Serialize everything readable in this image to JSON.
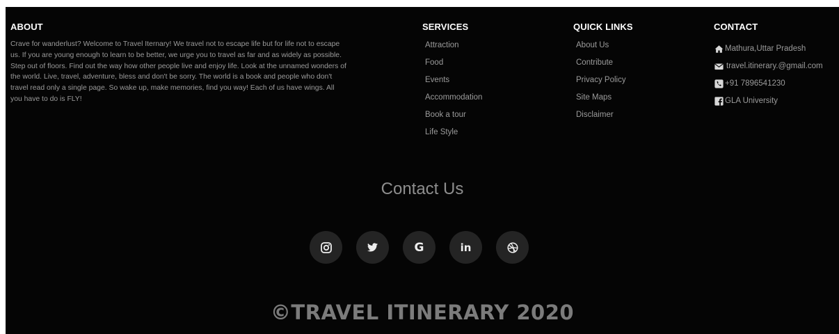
{
  "about": {
    "heading": "ABOUT",
    "text": "Crave for wanderlust? Welcome to Travel Iternary! We travel not to escape life but for life not to escape us. If you are young enough to learn to be better, we urge you to travel as far and as widely as possible. Step out of floors. Find out the way how other people live and enjoy life. Look at the unnamed wonders of the world. Live, travel, adventure, bless and don't be sorry. The world is a book and people who don't travel read only a single page. So wake up, make memories, find you way! Each of us have wings. All you have to do is FLY!"
  },
  "services": {
    "heading": "SERVICES",
    "items": [
      "Attraction",
      "Food",
      "Events",
      "Accommodation",
      "Book a tour",
      "Life Style"
    ]
  },
  "quick_links": {
    "heading": "QUICK LINKS",
    "items": [
      "About Us",
      "Contribute",
      "Privacy Policy",
      "Site Maps",
      "Disclaimer"
    ]
  },
  "contact": {
    "heading": "CONTACT",
    "items": [
      {
        "icon": "home-icon",
        "text": "Mathura,Uttar Pradesh"
      },
      {
        "icon": "envelope-icon",
        "text": "travel.itinerary.@gmail.com"
      },
      {
        "icon": "phone-icon",
        "text": "+91 7896541230"
      },
      {
        "icon": "facebook-icon",
        "text": "GLA University"
      }
    ]
  },
  "contact_us": {
    "title": "Contact Us",
    "socials": [
      {
        "icon": "instagram-icon",
        "glyph": ""
      },
      {
        "icon": "twitter-icon",
        "glyph": ""
      },
      {
        "icon": "google-icon",
        "glyph": "G"
      },
      {
        "icon": "linkedin-icon",
        "glyph": "in"
      },
      {
        "icon": "dribbble-icon",
        "glyph": ""
      }
    ]
  },
  "copyright": "©TRAVEL ITINERARY 2020",
  "colors": {
    "background": "#050505",
    "heading": "#ffffff",
    "text": "#9b9b9b",
    "social_bg": "#242424"
  }
}
